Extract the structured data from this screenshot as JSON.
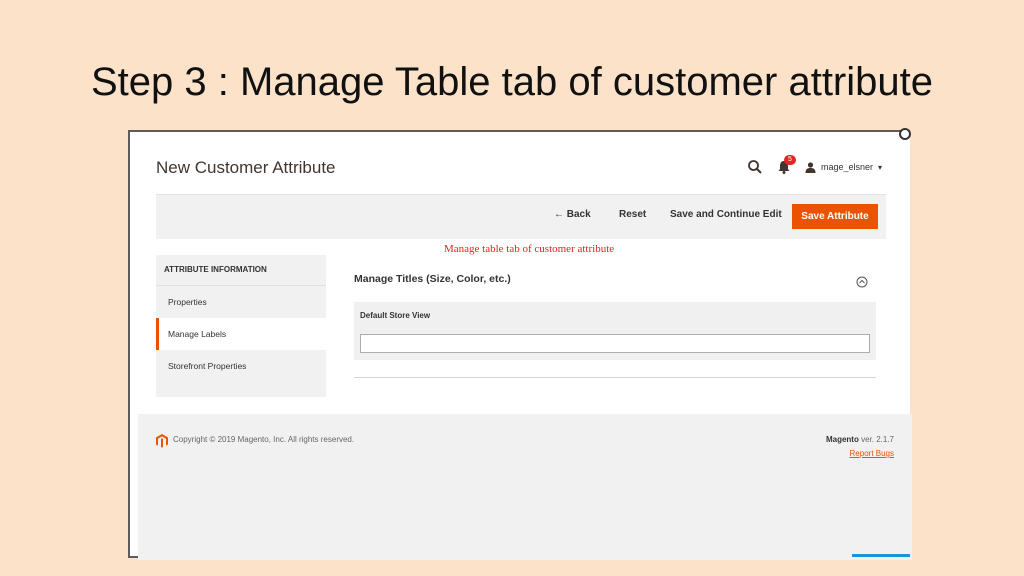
{
  "slide": {
    "title": "Step 3 : Manage Table tab of customer attribute"
  },
  "header": {
    "page_title": "New Customer Attribute",
    "notifications_count": "5",
    "username": "mage_elsner"
  },
  "toolbar": {
    "back_label": "← Back",
    "reset_label": "Reset",
    "save_continue_label": "Save and Continue Edit",
    "save_label": "Save Attribute"
  },
  "annotation": "Manage table tab of customer attribute",
  "sidebar": {
    "heading": "ATTRIBUTE INFORMATION",
    "items": [
      {
        "label": "Properties"
      },
      {
        "label": "Manage Labels"
      },
      {
        "label": "Storefront Properties"
      }
    ]
  },
  "main": {
    "section_title": "Manage Titles (Size, Color, etc.)",
    "column_header": "Default Store View",
    "default_store_view_value": ""
  },
  "footer": {
    "copyright": "Copyright © 2019 Magento, Inc. All rights reserved.",
    "brand": "Magento",
    "version": " ver. 2.1.7",
    "report_bugs": "Report Bugs"
  },
  "colors": {
    "slide_background": "#fbe2c9",
    "accent": "#eb5202",
    "annotation": "#e0231f"
  }
}
